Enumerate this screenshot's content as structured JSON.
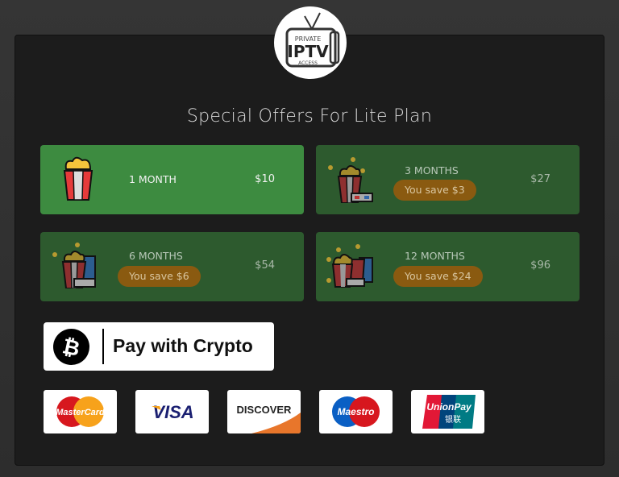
{
  "logo": {
    "top_text": "PRIVATE",
    "main_text": "IPTV",
    "bottom_text": "ACCESS"
  },
  "title": "Special Offers For Lite Plan",
  "plans": [
    {
      "duration": "1 MONTH",
      "price": "$10",
      "savings": null,
      "selected": true,
      "icon": "popcorn-icon"
    },
    {
      "duration": "3 MONTHS",
      "price": "$27",
      "savings": "You save $3",
      "selected": false,
      "icon": "popcorn-3d-glasses-icon"
    },
    {
      "duration": "6 MONTHS",
      "price": "$54",
      "savings": "You save $6",
      "selected": false,
      "icon": "popcorn-drink-3d-glasses-icon"
    },
    {
      "duration": "12 MONTHS",
      "price": "$96",
      "savings": "You save $24",
      "selected": false,
      "icon": "popcorn-combo-icon"
    }
  ],
  "crypto_button": {
    "label": "Pay with Crypto",
    "icon": "bitcoin-icon"
  },
  "payment_cards": [
    {
      "name": "MasterCard"
    },
    {
      "name": "VISA"
    },
    {
      "name": "DISCOVER"
    },
    {
      "name": "Maestro"
    },
    {
      "name": "UnionPay",
      "sub": "银联"
    }
  ],
  "colors": {
    "selected_plan": "#3d8b40",
    "plan": "#2d5a2e",
    "savings_badge": "#8a5a10",
    "panel": "#1c1c1c"
  }
}
